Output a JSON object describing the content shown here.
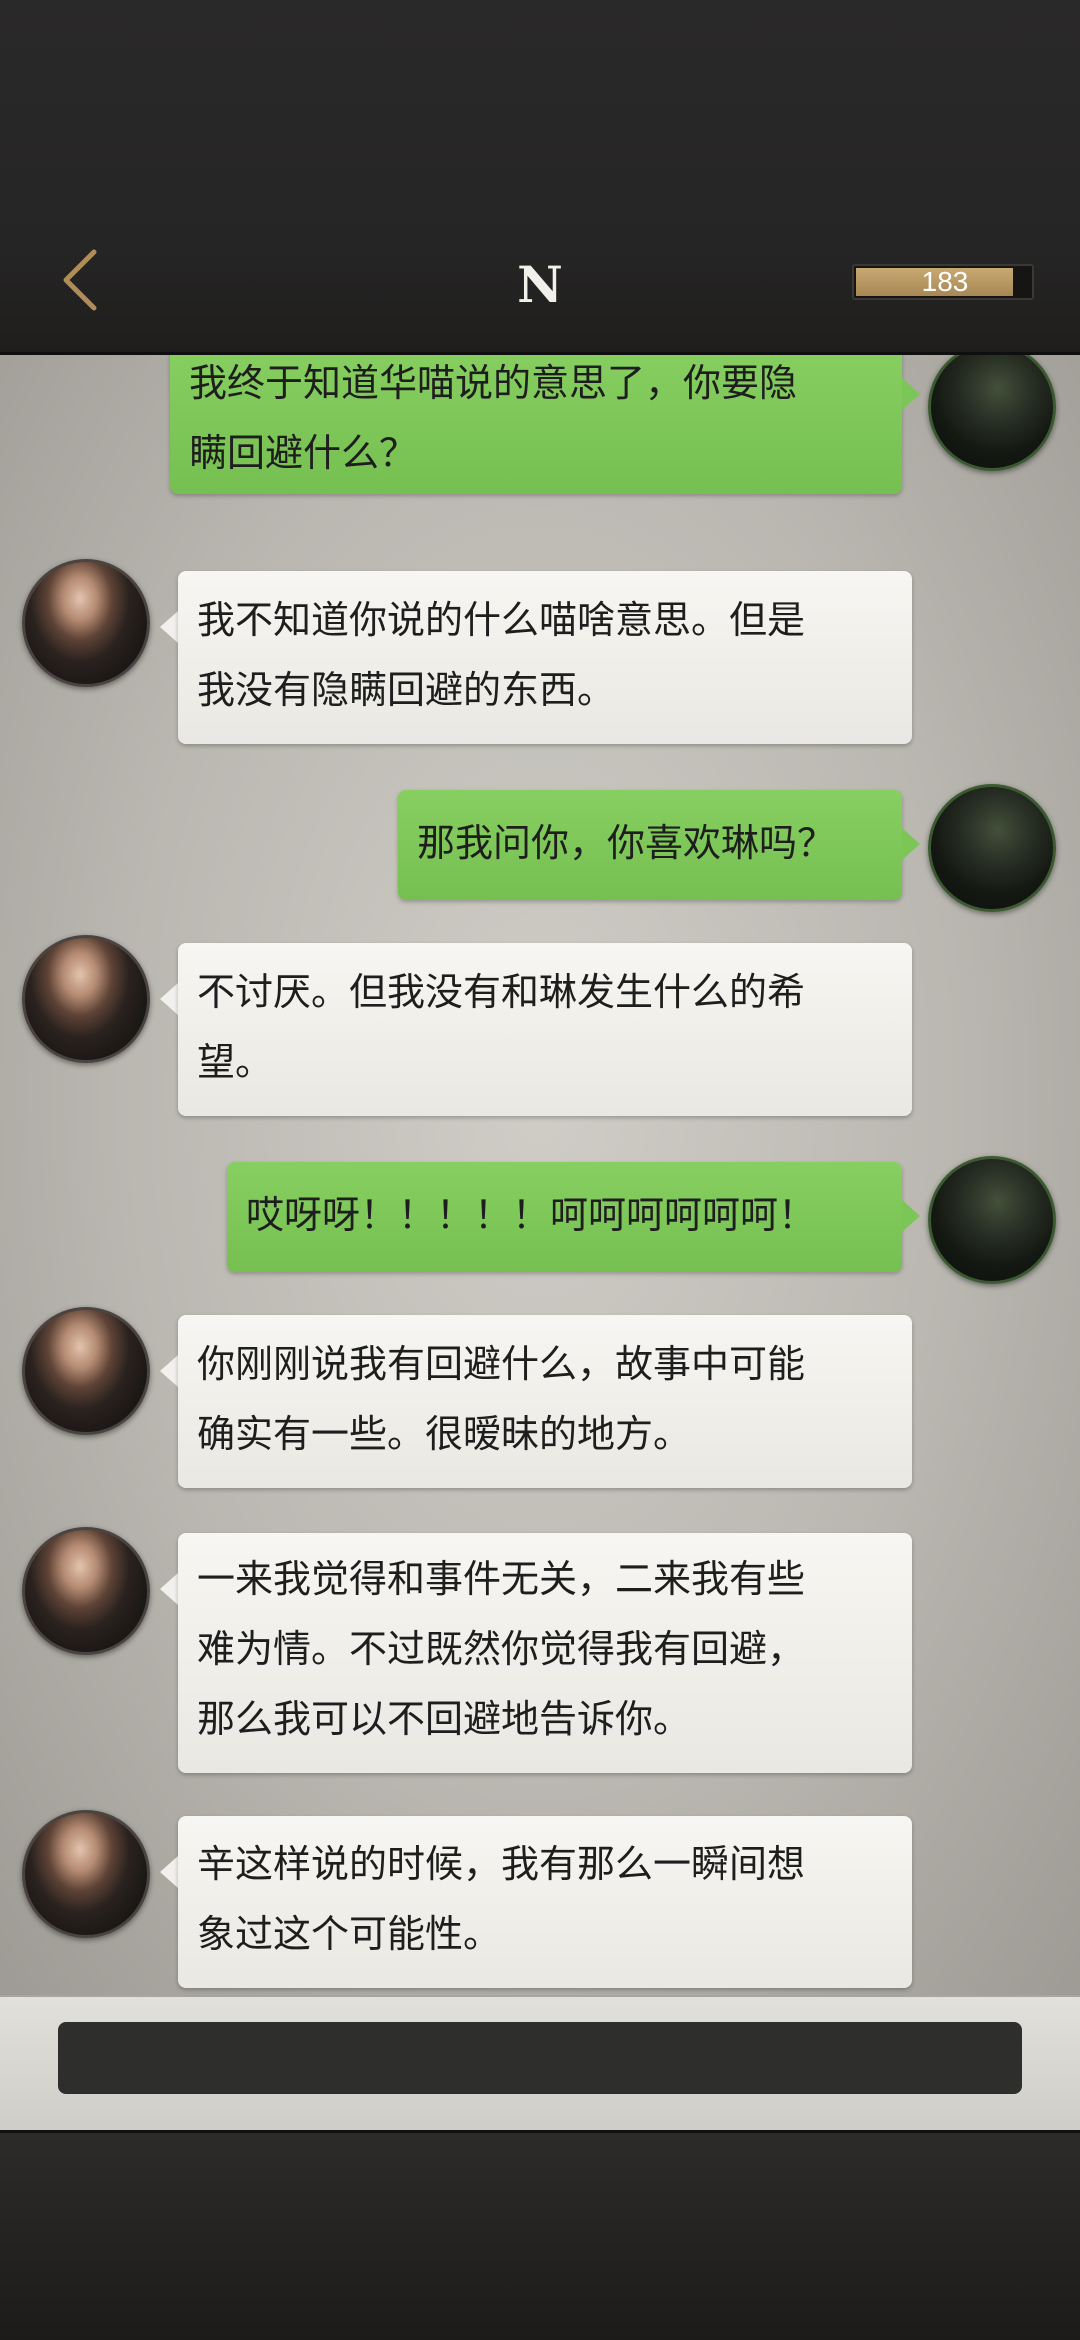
{
  "header": {
    "title": "N",
    "counter": "183",
    "counter_level": 0.88,
    "back_icon": "chevron-left-icon",
    "accent_color": "#b08d57"
  },
  "messages": [
    {
      "from": "self",
      "text": "我终于知道华喵说的意思了，你要隐\n瞒回避什么？"
    },
    {
      "from": "N",
      "text": "我不知道你说的什么喵啥意思。但是\n我没有隐瞒回避的东西。"
    },
    {
      "from": "self",
      "text": "那我问你，你喜欢琳吗？"
    },
    {
      "from": "N",
      "text": "不讨厌。但我没有和琳发生什么的希\n望。"
    },
    {
      "from": "self",
      "text": "哎呀呀！！！！！呵呵呵呵呵呵！"
    },
    {
      "from": "N",
      "text": "你刚刚说我有回避什么，故事中可能\n确实有一些。很暧昧的地方。"
    },
    {
      "from": "N",
      "text": "一来我觉得和事件无关，二来我有些\n难为情。不过既然你觉得我有回避，\n那么我可以不回避地告诉你。"
    },
    {
      "from": "N",
      "text": "辛这样说的时候，我有那么一瞬间想\n象过这个可能性。"
    }
  ],
  "input": {
    "value": ""
  },
  "colors": {
    "self_bubble": "#7fc85a",
    "n_bubble": "#f1f0ec",
    "background": "#bab8b1"
  }
}
